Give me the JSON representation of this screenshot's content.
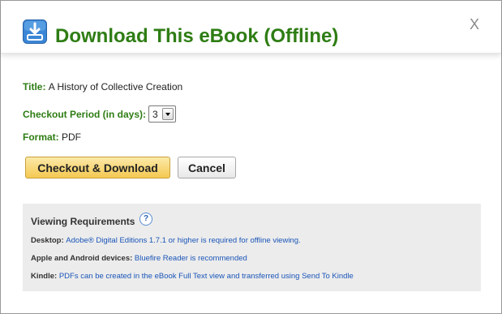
{
  "dialog": {
    "title": "Download This eBook (Offline)",
    "close_label": "X",
    "icon": "download-icon",
    "accent_color": "#2e7d14"
  },
  "details": {
    "title_label": "Title:",
    "title_value": "A History of Collective Creation",
    "period_label": "Checkout Period (in days):",
    "period_value": "3",
    "format_label": "Format:",
    "format_value": "PDF"
  },
  "actions": {
    "checkout_label": "Checkout & Download",
    "cancel_label": "Cancel"
  },
  "requirements": {
    "title": "Viewing Requirements",
    "help_label": "?",
    "items": [
      {
        "label": "Desktop:",
        "text": "Adobe® Digital Editions 1.7.1 or higher is required for offline viewing."
      },
      {
        "label": "Apple and Android devices:",
        "text": "Bluefire Reader is recommended"
      },
      {
        "label": "Kindle:",
        "text": "PDFs can be created in the eBook Full Text view and transferred using Send To Kindle"
      }
    ]
  }
}
